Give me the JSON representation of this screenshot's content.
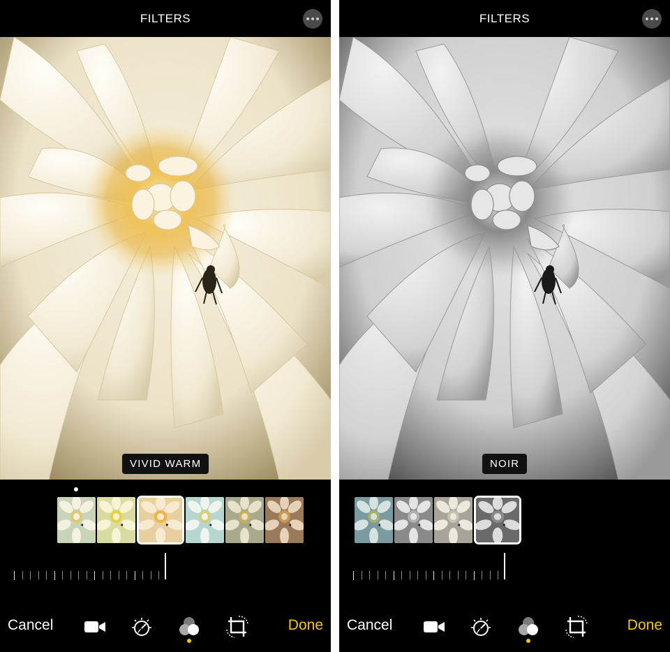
{
  "screens": [
    {
      "title": "FILTERS",
      "filter_name": "VIVID WARM",
      "photo_style": "color",
      "cancel_label": "Cancel",
      "done_label": "Done",
      "active_tool": "filters",
      "thumbnails": [
        {
          "style": "original"
        },
        {
          "style": "vivid"
        },
        {
          "style": "vivid-warm",
          "selected": true
        },
        {
          "style": "vivid-cool"
        },
        {
          "style": "dramatic"
        },
        {
          "style": "dramatic-warm"
        }
      ]
    },
    {
      "title": "FILTERS",
      "filter_name": "NOIR",
      "photo_style": "grayscale",
      "cancel_label": "Cancel",
      "done_label": "Done",
      "active_tool": "filters",
      "thumbnails": [
        {
          "style": "dramatic-cool"
        },
        {
          "style": "mono"
        },
        {
          "style": "silvertone"
        },
        {
          "style": "noir",
          "selected": true
        }
      ]
    }
  ],
  "icons": {
    "more": "more-icon",
    "video": "video-camera-icon",
    "adjust": "adjust-dial-icon",
    "filters": "filters-icon",
    "crop": "crop-rotate-icon"
  },
  "colors": {
    "accent": "#f5c518",
    "background": "#000000",
    "text": "#ffffff"
  }
}
